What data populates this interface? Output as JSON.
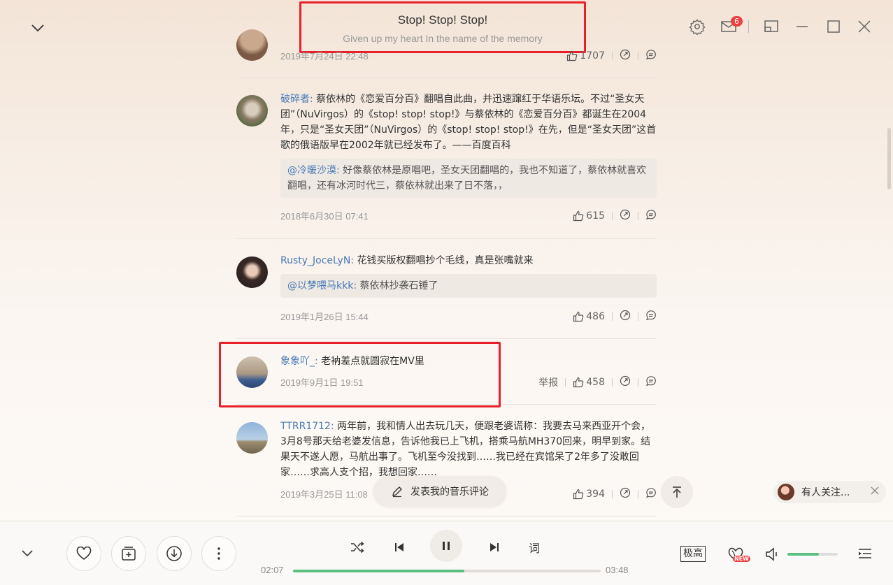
{
  "header": {
    "title": "Stop! Stop! Stop!",
    "subtitle": "Given up my heart In the name of the memory",
    "mail_count": "6"
  },
  "comments": [
    {
      "id": 0,
      "time": "2019年7月24日 22:48",
      "likes": "1707"
    },
    {
      "id": 1,
      "user": "破碎者",
      "text": "蔡依林的《恋爱百分百》翻唱自此曲，并迅速蹿红于华语乐坛。不过“圣女天团”（NuVirgos）的《stop! stop! stop!》与蔡依林的《恋爱百分百》都诞生在2004年，只是“圣女天团”（NuVirgos）的《stop! stop! stop!》在先，但是“圣女天团”这首歌的俄语版早在2002年就已经发布了。——百度百科",
      "reply_user": "@冷暖沙漠",
      "reply_text": "好像蔡依林是原唱吧，圣女天团翻唱的，我也不知道了，蔡依林就喜欢翻唱，还有冰河时代三，蔡依林就出来了日不落，，",
      "time": "2018年6月30日 07:41",
      "likes": "615"
    },
    {
      "id": 2,
      "user": "Rusty_JoceLyN",
      "text": "花钱买版权翻唱抄个毛线，真是张嘴就来",
      "reply_user": "@以梦喂马kkk",
      "reply_text": "蔡依林抄袭石锤了",
      "time": "2019年1月26日 15:44",
      "likes": "486"
    },
    {
      "id": 3,
      "user": "象象吖_",
      "text": "老衲差点就圆寂在MV里",
      "time": "2019年9月1日 19:51",
      "report": "举报",
      "likes": "458"
    },
    {
      "id": 4,
      "user": "TTRR1712",
      "text": "两年前，我和情人出去玩几天，便跟老婆谎称：我要去马来西亚开个会，3月8号那天给老婆发信息，告诉他我已上飞机，搭乘马航MH370回来，明早到家。结果天不遂人愿，马航出事了。飞机至今没找到……我已经在宾馆呆了2年多了没敢回家……求高人支个招，我想回家……",
      "time": "2019年3月25日 11:08",
      "likes": "394"
    }
  ],
  "compose_label": "发表我的音乐评论",
  "follow_toast": "有人关注...",
  "player": {
    "current_time": "02:07",
    "total_time": "03:48",
    "progress": 0.557,
    "volume": 0.63,
    "lyric_label": "词",
    "quality_label": "极高",
    "new_badge": "NEW"
  },
  "colors": {
    "accent_green": "#5cc082",
    "badge_red": "#ec4141",
    "user_link": "#4a7bb7",
    "highlight_red": "#e8202a"
  }
}
